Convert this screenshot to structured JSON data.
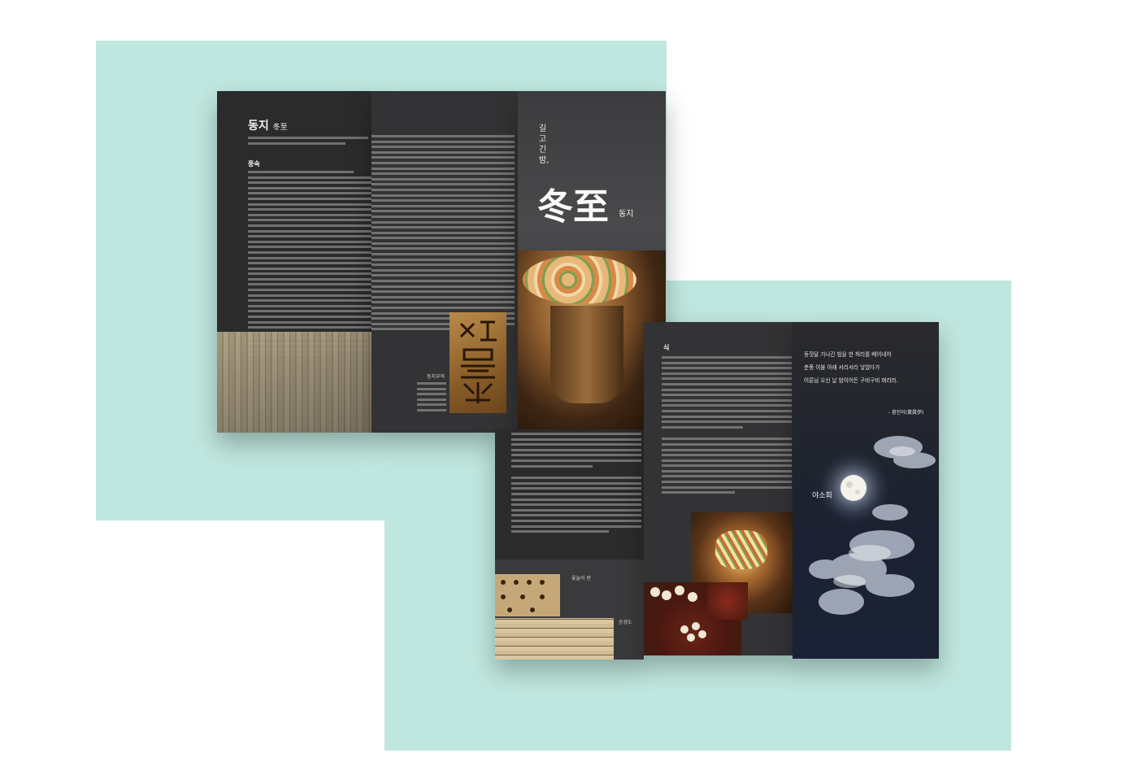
{
  "brochure_front": {
    "title_ko": "동지",
    "title_hanja": "冬至",
    "section_heading": "풍속",
    "photo_caption": "동지부적",
    "cover_tagline": [
      "길",
      "고",
      "긴",
      "밤,"
    ],
    "cover_big_title": "冬至",
    "cover_small_title": "동지"
  },
  "brochure_back": {
    "section_heading_partial": "식",
    "board_caption": "윷놀이 판",
    "board_caption_2": "승경도",
    "poem_lines": [
      "동짓달 기나긴 밤을 한 허리를 베어내어",
      "춘풍 이불 아래 서리서리 넣었다가",
      "어룬님 오신 날 밤이어든 구비구비 펴리라."
    ],
    "poem_author": "- 황진이(黃眞伊)",
    "poem_title_vertical": "야소회"
  },
  "colors": {
    "mint_background": "#bfe7df",
    "panel_dark": "#2b2b2c"
  }
}
